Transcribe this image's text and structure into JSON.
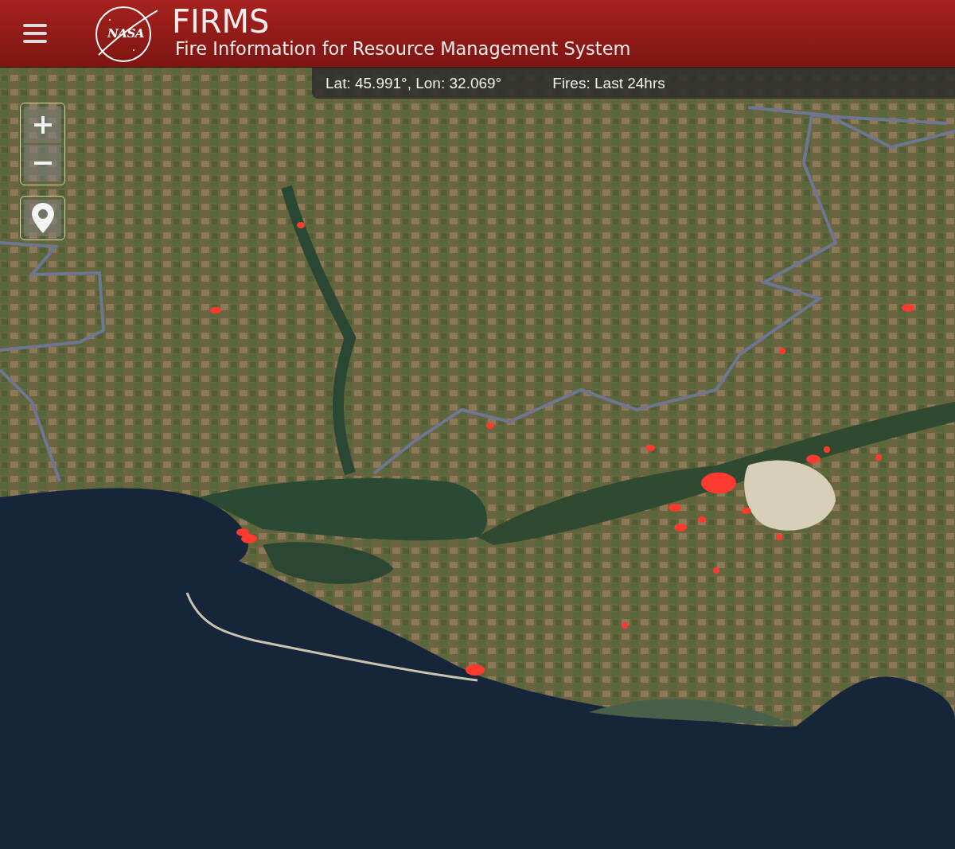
{
  "header": {
    "logo_text": "NASA",
    "title": "FIRMS",
    "subtitle": "Fire Information for Resource Management System"
  },
  "info_bar": {
    "coordinates": "Lat: 45.991°, Lon: 32.069°",
    "fires_period": "Fires: Last 24hrs"
  }
}
